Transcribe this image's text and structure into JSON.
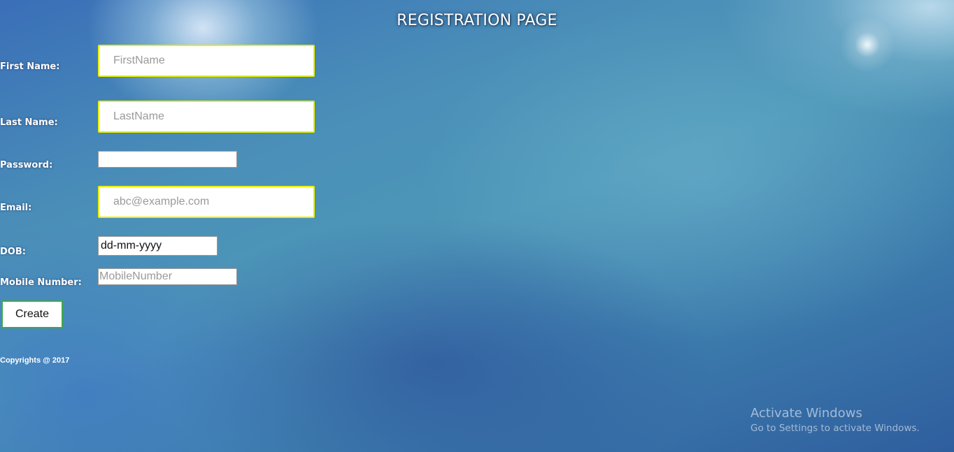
{
  "page": {
    "title": "REGISTRATION PAGE"
  },
  "form": {
    "first_name": {
      "label": "First Name:",
      "placeholder": "FirstName",
      "value": ""
    },
    "last_name": {
      "label": "Last Name:",
      "placeholder": "LastName",
      "value": ""
    },
    "password": {
      "label": "Password:",
      "value": ""
    },
    "email": {
      "label": "Email:",
      "placeholder": "abc@example.com",
      "value": ""
    },
    "dob": {
      "label": "DOB:",
      "display": "dd-mm-yyyy"
    },
    "mobile": {
      "label": "Mobile Number:",
      "placeholder": "MobileNumber",
      "value": ""
    },
    "submit_label": "Create"
  },
  "footer": {
    "copyright": "Copyrights @ 2017"
  },
  "windows_watermark": {
    "line1": "Activate Windows",
    "line2": "Go to Settings to activate Windows."
  },
  "colors": {
    "input_border_highlight": "#e8f000",
    "button_border": "#3fa84a",
    "text": "#ffffff"
  }
}
